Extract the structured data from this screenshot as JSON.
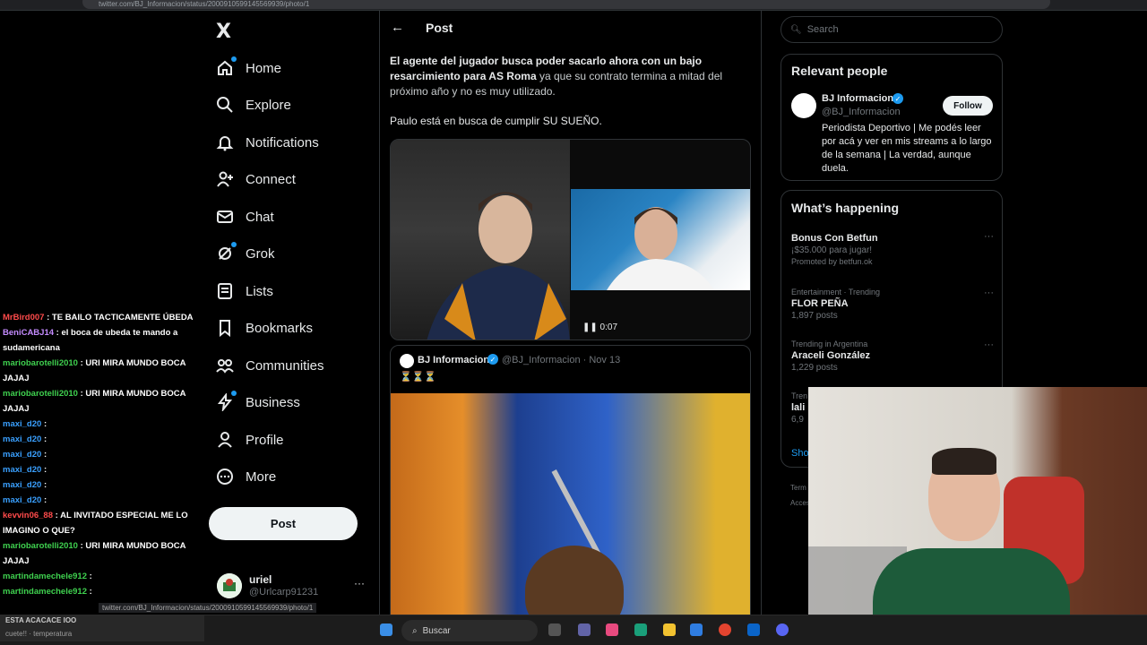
{
  "browser": {
    "url": "twitter.com/BJ_Informacion/status/2000910599145569939/photo/1"
  },
  "nav": {
    "logo": "X",
    "items": [
      {
        "label": "Home",
        "icon": "home-icon"
      },
      {
        "label": "Explore",
        "icon": "search-icon"
      },
      {
        "label": "Notifications",
        "icon": "bell-icon"
      },
      {
        "label": "Connect",
        "icon": "add-person-icon"
      },
      {
        "label": "Chat",
        "icon": "mail-icon"
      },
      {
        "label": "Grok",
        "icon": "grok-icon"
      },
      {
        "label": "Lists",
        "icon": "list-icon"
      },
      {
        "label": "Bookmarks",
        "icon": "bookmark-icon"
      },
      {
        "label": "Communities",
        "icon": "communities-icon"
      },
      {
        "label": "Business",
        "icon": "lightning-icon"
      },
      {
        "label": "Profile",
        "icon": "person-icon"
      },
      {
        "label": "More",
        "icon": "more-circle-icon"
      }
    ],
    "post_label": "Post",
    "account": {
      "name": "uriel",
      "handle": "@Urlcarp91231",
      "more": "···"
    }
  },
  "main": {
    "back": "←",
    "title": "Post",
    "tweet": {
      "bold_text": "El agente del jugador busca poder sacarlo ahora con un bajo resarcimiento para AS Roma",
      "normal_text": " ya que su contrato termina a mitad del próximo año y no es muy utilizado.",
      "text2": "Paulo está en busca de cumplir SU SUEÑO.",
      "video_time": "0:07"
    },
    "quote": {
      "name": "BJ Informacion",
      "handle": "@BJ_Informacion · Nov 13",
      "text": "⏳⏳⏳"
    }
  },
  "right": {
    "search_placeholder": "Search",
    "relevant": {
      "title": "Relevant people",
      "name": "BJ Informacion",
      "handle": "@BJ_Informacion",
      "follow": "Follow",
      "bio": "Periodista Deportivo | Me podés leer por acá y ver en mis streams a lo largo de la semana | La verdad, aunque duela."
    },
    "happening": {
      "title": "What’s happening",
      "trends": [
        {
          "ctx": "",
          "title": "Bonus Con Betfun",
          "sub": "¡$35.000 para jugar!",
          "sub2": "Promoted by betfun.ok"
        },
        {
          "ctx": "Entertainment · Trending",
          "title": "FLOR PEÑA",
          "sub": "1,897 posts",
          "sub2": ""
        },
        {
          "ctx": "Trending in Argentina",
          "title": "Araceli González",
          "sub": "1,229 posts",
          "sub2": ""
        },
        {
          "ctx": "Tren",
          "title": "lali",
          "sub": "6,9",
          "sub2": ""
        }
      ],
      "show_more": "Show"
    },
    "footer": {
      "terms": "Term",
      "access": "Acces"
    }
  },
  "chat": {
    "colors": {
      "green": "#3fd14f",
      "red": "#ff4b4b",
      "purple": "#c48bff",
      "blue": "#3aa0ff"
    },
    "lines": [
      {
        "user": "MrBird007",
        "msg": ": TE BAILO TACTICAMENTE ÚBEDA",
        "color": "red"
      },
      {
        "user": "BeniCABJ14",
        "msg": ": el boca de ubeda te mando a sudamericana",
        "color": "purple"
      },
      {
        "user": "mariobarotelli2010",
        "msg": ": URI MIRA MUNDO BOCA JAJAJ",
        "color": "green"
      },
      {
        "user": "mariobarotelli2010",
        "msg": ": URI MIRA MUNDO BOCA JAJAJ",
        "color": "green"
      },
      {
        "user": "maxi_d20",
        "msg": ":",
        "color": "blue"
      },
      {
        "user": "maxi_d20",
        "msg": ":",
        "color": "blue"
      },
      {
        "user": "maxi_d20",
        "msg": ":",
        "color": "blue"
      },
      {
        "user": "maxi_d20",
        "msg": ":",
        "color": "blue"
      },
      {
        "user": "maxi_d20",
        "msg": ":",
        "color": "blue"
      },
      {
        "user": "maxi_d20",
        "msg": ":",
        "color": "blue"
      },
      {
        "user": "kevvin06_88",
        "msg": ": AL INVITADO ESPECIAL ME LO IMAGINO O QUE?",
        "color": "red"
      },
      {
        "user": "mariobarotelli2010",
        "msg": ": URI MIRA MUNDO BOCA JAJAJ",
        "color": "green"
      },
      {
        "user": "martindamechele912",
        "msg": ":",
        "color": "green"
      },
      {
        "user": "martindamechele912",
        "msg": ":",
        "color": "green"
      }
    ]
  },
  "obs": {
    "line1": "ESTA ACACACE IOO",
    "line2": "cuete!! · temperatura"
  },
  "taskbar": {
    "search": "Buscar"
  }
}
